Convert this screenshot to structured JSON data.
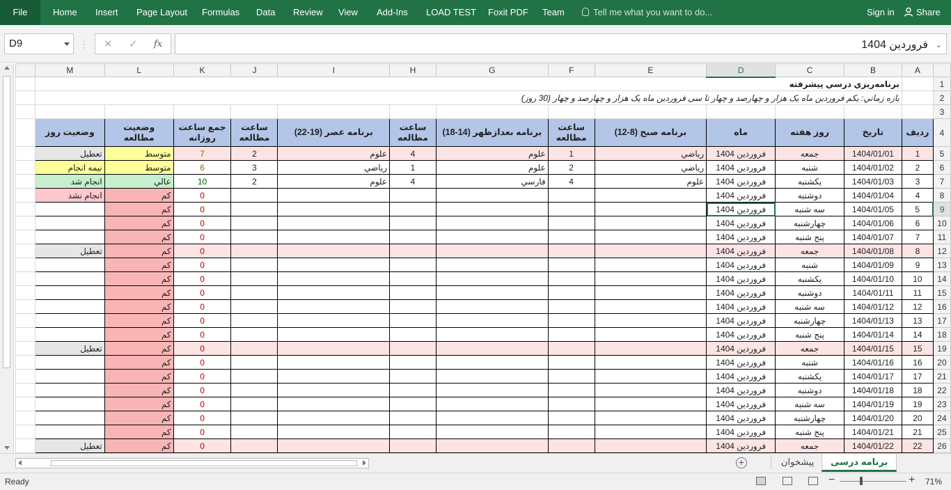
{
  "ribbon": {
    "file": "File",
    "tabs": [
      "Home",
      "Insert",
      "Page Layout",
      "Formulas",
      "Data",
      "Review",
      "View",
      "Add-Ins",
      "LOAD TEST",
      "Foxit PDF",
      "Team"
    ],
    "tell_me": "Tell me what you want to do...",
    "sign_in": "Sign in",
    "share": "Share"
  },
  "formula_bar": {
    "name_box": "D9",
    "cancel": "✕",
    "enter": "✓",
    "fx": "fx",
    "value": "فروردین 1404"
  },
  "columns": [
    "M",
    "L",
    "K",
    "J",
    "I",
    "H",
    "G",
    "F",
    "E",
    "D",
    "C",
    "B",
    "A"
  ],
  "sheet": {
    "title": "برنامه‌ریزي درسي پیشرفته",
    "subtitle": "بازه زماني: یکم فروردین ماه یک هزار و چهارصد و چهار تا سی فروردین ماه یک هزار و چهارصد و چهار (30 روز)",
    "headers": {
      "radif": "ردیف",
      "tarikh": "تاریخ",
      "rooz": "روز هفته",
      "mah": "ماه",
      "sobh": "برنامه صبح (8-12)",
      "saat1": "ساعت مطالعه",
      "badazohr": "برنامه بعدازظهر (14-18)",
      "saat2": "ساعت مطالعه",
      "asr": "برنامه عصر (19-22)",
      "saat3": "ساعت مطالعه",
      "jam": "جمع ساعت روزانه",
      "vaziat_motaleh": "وضعیت مطالعه",
      "vaziat_rooz": "وضعیت روز"
    },
    "rows": [
      {
        "r": "1",
        "date": "1404/01/01",
        "day": "جمعه",
        "month": "فروردین 1404",
        "morning": "رياضي",
        "h1": "1",
        "afternoon": "علوم",
        "h2": "4",
        "evening": "علوم",
        "h3": "2",
        "total": "7",
        "study": "متوسط",
        "status": "تعطیل"
      },
      {
        "r": "2",
        "date": "1404/01/02",
        "day": "شنبه",
        "month": "فروردین 1404",
        "morning": "رياضي",
        "h1": "2",
        "afternoon": "علوم",
        "h2": "1",
        "evening": "رياضي",
        "h3": "3",
        "total": "6",
        "study": "متوسط",
        "status": "نیمه انجام"
      },
      {
        "r": "3",
        "date": "1404/01/03",
        "day": "یکشنبه",
        "month": "فروردین 1404",
        "morning": "علوم",
        "h1": "4",
        "afternoon": "فارسي",
        "h2": "4",
        "evening": "علوم",
        "h3": "2",
        "total": "10",
        "study": "عالي",
        "status": "انجام شد"
      },
      {
        "r": "4",
        "date": "1404/01/04",
        "day": "دوشنبه",
        "month": "فروردین 1404",
        "morning": "",
        "h1": "",
        "afternoon": "",
        "h2": "",
        "evening": "",
        "h3": "",
        "total": "0",
        "study": "کم",
        "status": "انجام نشد"
      },
      {
        "r": "5",
        "date": "1404/01/05",
        "day": "سه شنبه",
        "month": "فروردین 1404",
        "morning": "",
        "h1": "",
        "afternoon": "",
        "h2": "",
        "evening": "",
        "h3": "",
        "total": "0",
        "study": "کم",
        "status": ""
      },
      {
        "r": "6",
        "date": "1404/01/06",
        "day": "چهارشنبه",
        "month": "فروردین 1404",
        "morning": "",
        "h1": "",
        "afternoon": "",
        "h2": "",
        "evening": "",
        "h3": "",
        "total": "0",
        "study": "کم",
        "status": ""
      },
      {
        "r": "7",
        "date": "1404/01/07",
        "day": "پنج شنبه",
        "month": "فروردین 1404",
        "morning": "",
        "h1": "",
        "afternoon": "",
        "h2": "",
        "evening": "",
        "h3": "",
        "total": "0",
        "study": "کم",
        "status": ""
      },
      {
        "r": "8",
        "date": "1404/01/08",
        "day": "جمعه",
        "month": "فروردین 1404",
        "morning": "",
        "h1": "",
        "afternoon": "",
        "h2": "",
        "evening": "",
        "h3": "",
        "total": "0",
        "study": "کم",
        "status": "تعطیل"
      },
      {
        "r": "9",
        "date": "1404/01/09",
        "day": "شنبه",
        "month": "فروردین 1404",
        "morning": "",
        "h1": "",
        "afternoon": "",
        "h2": "",
        "evening": "",
        "h3": "",
        "total": "0",
        "study": "کم",
        "status": ""
      },
      {
        "r": "10",
        "date": "1404/01/10",
        "day": "یکشنبه",
        "month": "فروردین 1404",
        "morning": "",
        "h1": "",
        "afternoon": "",
        "h2": "",
        "evening": "",
        "h3": "",
        "total": "0",
        "study": "کم",
        "status": ""
      },
      {
        "r": "11",
        "date": "1404/01/11",
        "day": "دوشنبه",
        "month": "فروردین 1404",
        "morning": "",
        "h1": "",
        "afternoon": "",
        "h2": "",
        "evening": "",
        "h3": "",
        "total": "0",
        "study": "کم",
        "status": ""
      },
      {
        "r": "12",
        "date": "1404/01/12",
        "day": "سه شنبه",
        "month": "فروردین 1404",
        "morning": "",
        "h1": "",
        "afternoon": "",
        "h2": "",
        "evening": "",
        "h3": "",
        "total": "0",
        "study": "کم",
        "status": ""
      },
      {
        "r": "13",
        "date": "1404/01/13",
        "day": "چهارشنبه",
        "month": "فروردین 1404",
        "morning": "",
        "h1": "",
        "afternoon": "",
        "h2": "",
        "evening": "",
        "h3": "",
        "total": "0",
        "study": "کم",
        "status": ""
      },
      {
        "r": "14",
        "date": "1404/01/14",
        "day": "پنج شنبه",
        "month": "فروردین 1404",
        "morning": "",
        "h1": "",
        "afternoon": "",
        "h2": "",
        "evening": "",
        "h3": "",
        "total": "0",
        "study": "کم",
        "status": ""
      },
      {
        "r": "15",
        "date": "1404/01/15",
        "day": "جمعه",
        "month": "فروردین 1404",
        "morning": "",
        "h1": "",
        "afternoon": "",
        "h2": "",
        "evening": "",
        "h3": "",
        "total": "0",
        "study": "کم",
        "status": "تعطیل"
      },
      {
        "r": "16",
        "date": "1404/01/16",
        "day": "شنبه",
        "month": "فروردین 1404",
        "morning": "",
        "h1": "",
        "afternoon": "",
        "h2": "",
        "evening": "",
        "h3": "",
        "total": "0",
        "study": "کم",
        "status": ""
      },
      {
        "r": "17",
        "date": "1404/01/17",
        "day": "یکشنبه",
        "month": "فروردین 1404",
        "morning": "",
        "h1": "",
        "afternoon": "",
        "h2": "",
        "evening": "",
        "h3": "",
        "total": "0",
        "study": "کم",
        "status": ""
      },
      {
        "r": "18",
        "date": "1404/01/18",
        "day": "دوشنبه",
        "month": "فروردین 1404",
        "morning": "",
        "h1": "",
        "afternoon": "",
        "h2": "",
        "evening": "",
        "h3": "",
        "total": "0",
        "study": "کم",
        "status": ""
      },
      {
        "r": "19",
        "date": "1404/01/19",
        "day": "سه شنبه",
        "month": "فروردین 1404",
        "morning": "",
        "h1": "",
        "afternoon": "",
        "h2": "",
        "evening": "",
        "h3": "",
        "total": "0",
        "study": "کم",
        "status": ""
      },
      {
        "r": "20",
        "date": "1404/01/20",
        "day": "چهارشنبه",
        "month": "فروردین 1404",
        "morning": "",
        "h1": "",
        "afternoon": "",
        "h2": "",
        "evening": "",
        "h3": "",
        "total": "0",
        "study": "کم",
        "status": ""
      },
      {
        "r": "21",
        "date": "1404/01/21",
        "day": "پنج شنبه",
        "month": "فروردین 1404",
        "morning": "",
        "h1": "",
        "afternoon": "",
        "h2": "",
        "evening": "",
        "h3": "",
        "total": "0",
        "study": "کم",
        "status": ""
      },
      {
        "r": "22",
        "date": "1404/01/22",
        "day": "جمعه",
        "month": "فروردین 1404",
        "morning": "",
        "h1": "",
        "afternoon": "",
        "h2": "",
        "evening": "",
        "h3": "",
        "total": "0",
        "study": "کم",
        "status": "تعطیل"
      }
    ]
  },
  "sheet_tabs": {
    "active": "برنامه درسی",
    "other": "پیشخوان",
    "add": "+"
  },
  "status_bar": {
    "ready": "Ready",
    "zoom": "71%",
    "zoom_minus": "−",
    "zoom_plus": "+"
  },
  "colors": {
    "excel_green": "#217346",
    "header_blue": "#b4c6e7",
    "low_red": "#f9b5b5",
    "weekend_pink": "#fce4e4"
  }
}
